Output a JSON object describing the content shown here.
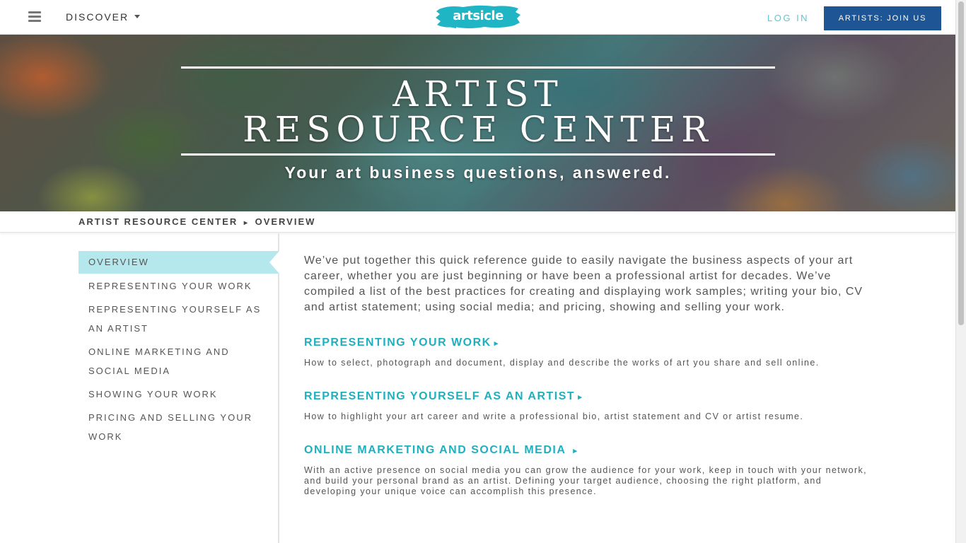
{
  "nav": {
    "discover_label": "DISCOVER",
    "logo_text": "artsicle",
    "login_label": "LOG IN",
    "join_label": "ARTISTS: JOIN US"
  },
  "hero": {
    "title_line1": "ARTIST",
    "title_line2": "RESOURCE CENTER",
    "subtitle": "Your art business questions, answered."
  },
  "breadcrumb": {
    "root": "ARTIST RESOURCE CENTER",
    "separator": "▸",
    "current": "OVERVIEW"
  },
  "sidebar": {
    "items": [
      {
        "label": "OVERVIEW",
        "active": true
      },
      {
        "label": "REPRESENTING YOUR WORK",
        "active": false
      },
      {
        "label": "REPRESENTING YOURSELF AS AN ARTIST",
        "active": false
      },
      {
        "label": "ONLINE MARKETING AND SOCIAL MEDIA",
        "active": false
      },
      {
        "label": "SHOWING YOUR WORK",
        "active": false
      },
      {
        "label": "PRICING AND SELLING YOUR WORK",
        "active": false
      }
    ]
  },
  "main": {
    "intro": "We’ve put together this quick reference guide to easily navigate the business aspects of your art career, whether you are just beginning or have been a professional artist for decades. We’ve compiled a list of the best practices for creating and displaying work samples; writing your bio, CV and artist statement; using social media; and pricing, showing and selling your work.",
    "sections": [
      {
        "title": "REPRESENTING YOUR WORK",
        "arrow": "▸",
        "description": "How to select, photograph and document, display and describe the works of art you share and sell online."
      },
      {
        "title": "REPRESENTING YOURSELF AS AN ARTIST",
        "arrow": "▸",
        "description": "How to highlight your art career and write a professional bio, artist statement and CV or artist resume."
      },
      {
        "title": "ONLINE MARKETING AND SOCIAL MEDIA",
        "arrow": "▸",
        "description": "With an active presence on social media you can grow the audience for your work, keep in touch with your network, and build your personal brand as an artist. Defining your target audience, choosing the right platform, and developing your unique voice can accomplish this presence."
      }
    ]
  },
  "colors": {
    "accent": "#1fb0bf",
    "brand_teal": "#20b5c4",
    "join_button": "#1e5594",
    "active_sidebar": "#b4e8ed",
    "login_link": "#5cc6d3"
  },
  "icons": {
    "menu": "hamburger-menu-icon",
    "dropdown": "chevron-down-icon",
    "section_arrow": "right-triangle-icon"
  }
}
